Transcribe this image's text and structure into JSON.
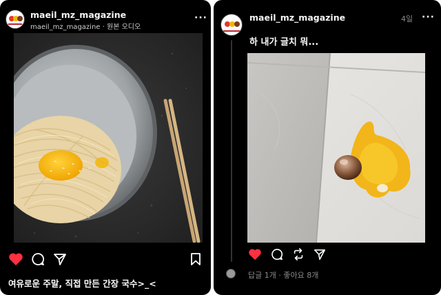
{
  "instagram": {
    "username": "maeil_mz_magazine",
    "audio_owner": "maeil_mz_magazine",
    "audio_label": "원본 오디오",
    "caption": "여유로운 주말, 직접 만든 간장 국수>_<"
  },
  "threads": {
    "username": "maeil_mz_magazine",
    "timestamp": "4일",
    "post_text": "하 내가 글치 뭐...",
    "replies": "답글 1개",
    "likes": "좋아요 8개"
  },
  "colors": {
    "like_active": "#ff3040",
    "panel_bg": "#000000",
    "muted_text": "#8a8a8a"
  }
}
